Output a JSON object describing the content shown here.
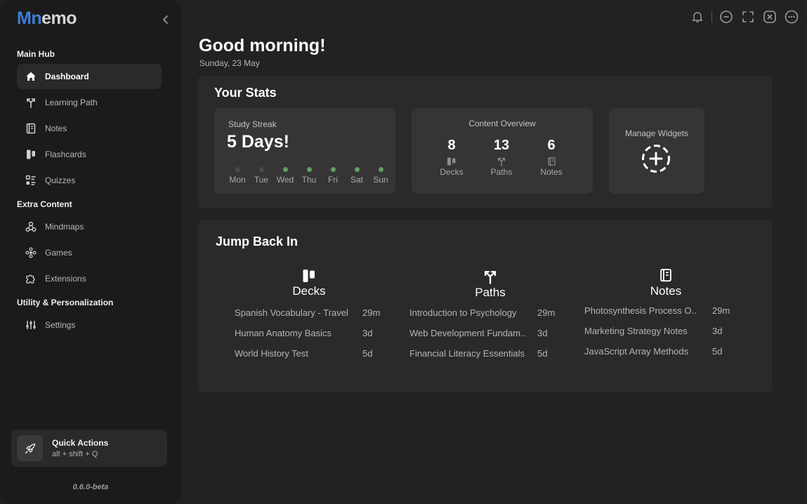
{
  "app": {
    "logo_a": "Mn",
    "logo_b": "emo",
    "version": "0.6.0-beta"
  },
  "sidebar": {
    "sections": {
      "main": "Main Hub",
      "extra": "Extra Content",
      "utility": "Utility & Personalization"
    },
    "items": [
      {
        "label": "Dashboard",
        "icon": "home-icon"
      },
      {
        "label": "Learning Path",
        "icon": "path-icon"
      },
      {
        "label": "Notes",
        "icon": "notebook-icon"
      },
      {
        "label": "Flashcards",
        "icon": "flashcards-icon"
      },
      {
        "label": "Quizzes",
        "icon": "list-icon"
      },
      {
        "label": "Mindmaps",
        "icon": "mindmap-icon"
      },
      {
        "label": "Games",
        "icon": "gamepad-icon"
      },
      {
        "label": "Extensions",
        "icon": "puzzle-icon"
      },
      {
        "label": "Settings",
        "icon": "sliders-icon"
      }
    ],
    "quick_actions": {
      "title": "Quick Actions",
      "shortcut": "alt + shift + Q"
    }
  },
  "header": {
    "greeting": "Good morning!",
    "date": "Sunday, 23 May"
  },
  "stats": {
    "title": "Your Stats",
    "streak": {
      "title": "Study Streak",
      "value": "5 Days!",
      "days": [
        {
          "label": "Mon",
          "active": false
        },
        {
          "label": "Tue",
          "active": false
        },
        {
          "label": "Wed",
          "active": true
        },
        {
          "label": "Thu",
          "active": true
        },
        {
          "label": "Fri",
          "active": true
        },
        {
          "label": "Sat",
          "active": true
        },
        {
          "label": "Sun",
          "active": true
        }
      ]
    },
    "overview": {
      "title": "Content Overview",
      "items": [
        {
          "value": "8",
          "label": "Decks"
        },
        {
          "value": "13",
          "label": "Paths"
        },
        {
          "value": "6",
          "label": "Notes"
        }
      ]
    },
    "widgets": {
      "title": "Manage Widgets"
    }
  },
  "jump": {
    "title": "Jump Back In",
    "columns": [
      {
        "title": "Decks",
        "items": [
          {
            "name": "Spanish Vocabulary - Travel",
            "time": "29m"
          },
          {
            "name": "Human Anatomy Basics",
            "time": "3d"
          },
          {
            "name": "World History Test",
            "time": "5d"
          }
        ]
      },
      {
        "title": "Paths",
        "items": [
          {
            "name": "Introduction to Psychology",
            "time": "29m"
          },
          {
            "name": "Web Development Fundam..",
            "time": "3d"
          },
          {
            "name": "Financial Literacy Essentials",
            "time": "5d"
          }
        ]
      },
      {
        "title": "Notes",
        "items": [
          {
            "name": "Photosynthesis Process O..",
            "time": "29m"
          },
          {
            "name": "Marketing Strategy Notes",
            "time": "3d"
          },
          {
            "name": "JavaScript Array Methods",
            "time": "5d"
          }
        ]
      }
    ]
  },
  "colors": {
    "accent_blue": "#3d7ed8",
    "streak_green": "#5f9e62",
    "background": "#222222",
    "sidebar": "#1b1b1b",
    "panel": "#2a2a2a",
    "card": "#353535"
  }
}
